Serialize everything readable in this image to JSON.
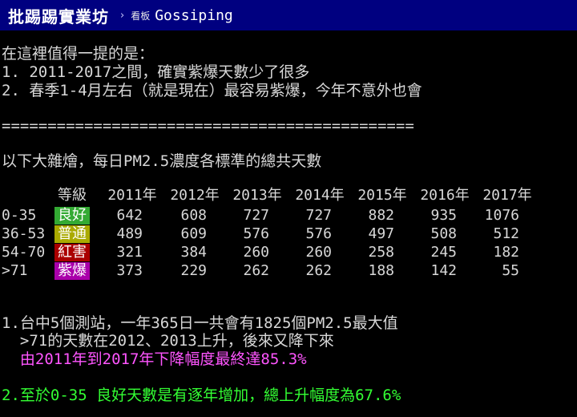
{
  "header": {
    "site_name": "批踢踢實業坊",
    "chevron": "›",
    "board_label": "看板",
    "board_name": "Gossiping"
  },
  "article": {
    "intro": "在這裡值得一提的是：",
    "point1": "1. 2011-2017之間，確實紫爆天數少了很多",
    "point2": "2. 春季1-4月左右（就是現在）最容易紫爆，今年不意外也會",
    "divider": "=============================================",
    "table_title": "以下大雜燴，每日PM2.5濃度各標準的總共天數",
    "note1_line1": "1.台中5個測站，一年365日一共會有1825個PM2.5最大值",
    "note1_line2": "  >71的天數在2012、2013上升，後來又降下來",
    "note1_line3": "  由2011年到2017年下降幅度最終達85.3%",
    "note2": "2.至於0-35 良好天數是有逐年增加，總上升幅度為67.6%"
  },
  "table": {
    "level_header": "等級",
    "years": [
      "2011年",
      "2012年",
      "2013年",
      "2014年",
      "2015年",
      "2016年",
      "2017年"
    ],
    "rows": [
      {
        "range": "0-35",
        "level": "良好",
        "level_color": "#33aa33",
        "values": [
          "642",
          "608",
          "727",
          "727",
          "882",
          "935",
          "1076"
        ]
      },
      {
        "range": "36-53",
        "level": "普通",
        "level_color": "#aaaa00",
        "values": [
          "489",
          "609",
          "576",
          "576",
          "497",
          "508",
          "512"
        ]
      },
      {
        "range": "54-70",
        "level": "紅害",
        "level_color": "#aa0000",
        "values": [
          "321",
          "384",
          "260",
          "260",
          "258",
          "245",
          "182"
        ]
      },
      {
        "range": ">71",
        "level": "紫爆",
        "level_color": "#aa00aa",
        "values": [
          "373",
          "229",
          "262",
          "262",
          "188",
          "142",
          "55"
        ]
      }
    ]
  },
  "colors": {
    "header_bg": "#000080",
    "text_default": "#d8d8d8",
    "text_green": "#33ff33",
    "text_magenta": "#ff55ff"
  }
}
